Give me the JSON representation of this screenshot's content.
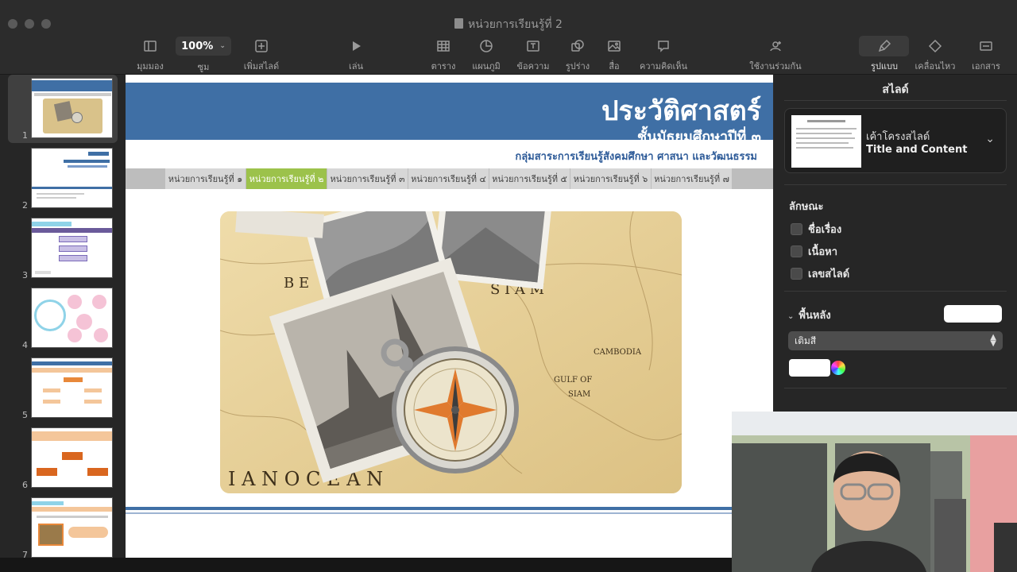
{
  "window": {
    "title": "หน่วยการเรียนรู้ที่ 2"
  },
  "toolbar": {
    "view": "มุมมอง",
    "zoom_value": "100%",
    "zoom": "ซูม",
    "add_slide": "เพิ่มสไลด์",
    "play": "เล่น",
    "table": "ตาราง",
    "chart": "แผนภูมิ",
    "text": "ข้อความ",
    "shape": "รูปร่าง",
    "media": "สื่อ",
    "comment": "ความคิดเห็น",
    "collaborate": "ใช้งานร่วมกัน",
    "format": "รูปแบบ",
    "animate": "เคลื่อนไหว",
    "document": "เอกสาร"
  },
  "slides": {
    "numbers": [
      "1",
      "2",
      "3",
      "4",
      "5",
      "6",
      "7"
    ],
    "selected": 1
  },
  "slide": {
    "title": "ประวัติศาสตร์",
    "subtitle": "ชั้นมัธยมศึกษาปีที่  ๓",
    "department": "กลุ่มสาระการเรียนรู้สังคมศึกษา ศาสนา และวัฒนธรรม",
    "tabs": [
      "หน่วยการเรียนรู้ที่ ๑",
      "หน่วยการเรียนรู้ที่ ๒",
      "หน่วยการเรียนรู้ที่ ๓",
      "หน่วยการเรียนรู้ที่ ๔",
      "หน่วยการเรียนรู้ที่ ๕",
      "หน่วยการเรียนรู้ที่ ๖",
      "หน่วยการเรียนรู้ที่ ๗"
    ],
    "active_tab": 1,
    "map_labels": {
      "be": "B E",
      "siam": "S I A M",
      "gulf": "GULF  OF",
      "siam2": "SIAM",
      "ocean": "I A N   O C E A N",
      "cambodia": "CAMBODIA"
    }
  },
  "inspector": {
    "title": "สไลด์",
    "layout_name_th": "เค้าโครงสไลด์",
    "layout_name_en": "Title and Content",
    "appearance_label": "ลักษณะ",
    "checkboxes": [
      "ชื่อเรื่อง",
      "เนื้อหา",
      "เลขสไลด์"
    ],
    "background_label": "พื้นหลัง",
    "fill_value": "เติมสี",
    "colors": {
      "background_swatch": "#ffffff"
    }
  },
  "colors": {
    "header_blue": "#3f6fa5",
    "tab_active_green": "#9cc24b"
  }
}
